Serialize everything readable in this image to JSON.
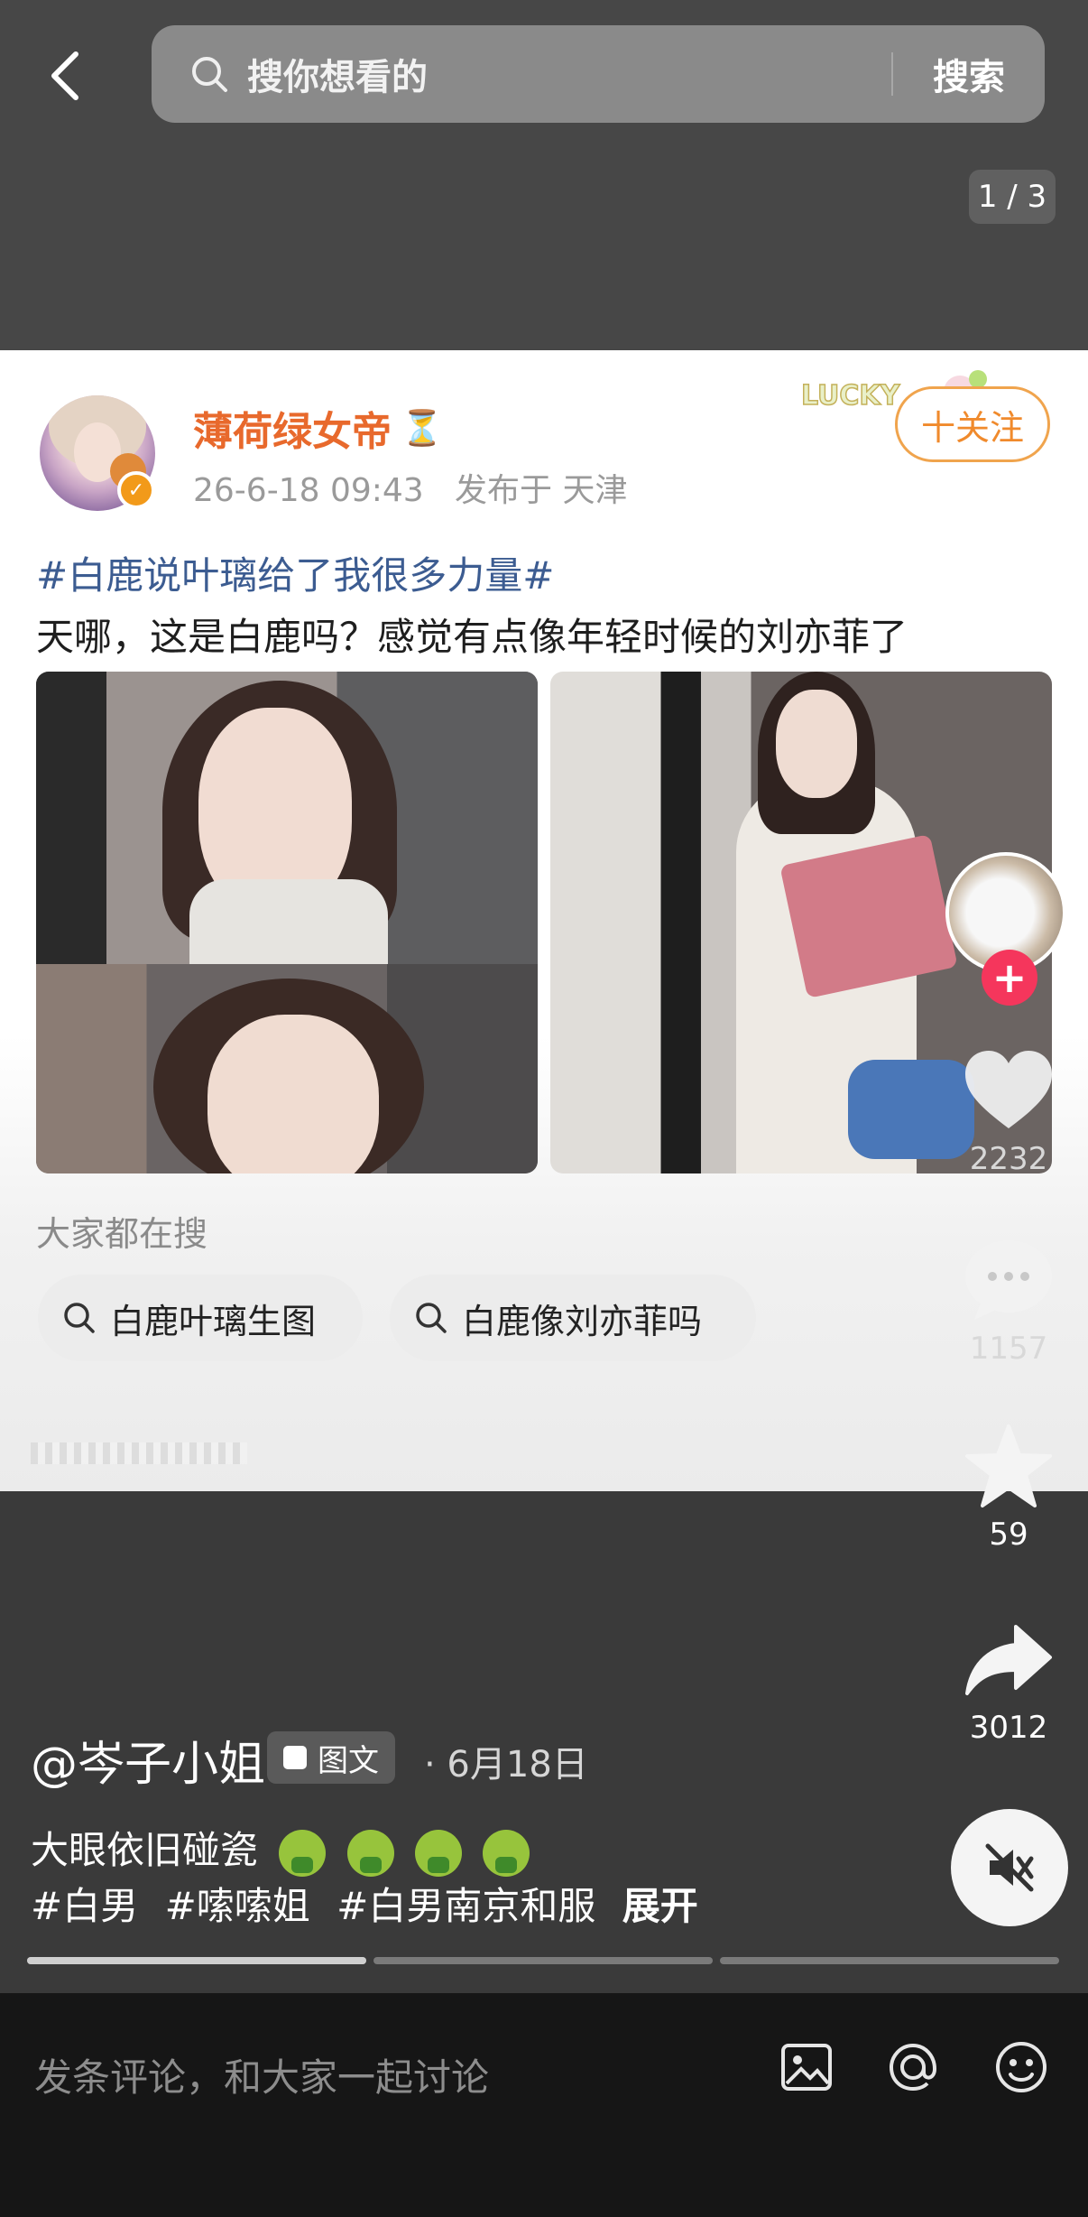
{
  "search": {
    "placeholder": "搜你想看的",
    "button_label": "搜索"
  },
  "pager": {
    "text": "1 / 3"
  },
  "post": {
    "author_name": "薄荷绿女帝",
    "author_emoji": "⏳",
    "timestamp": "26-6-18 09:43",
    "location": "发布于 天津",
    "follow_label": "十关注",
    "sticker_text": "LUCKY",
    "hashtag_title": "#白鹿说叶璃给了我很多力量#",
    "body": "天哪，这是白鹿吗？感觉有点像年轻时候的刘亦菲了",
    "related_label": "大家都在搜",
    "related_searches": [
      "白鹿叶璃生图",
      "白鹿像刘亦菲吗"
    ]
  },
  "actions": {
    "like_count": "2232",
    "comment_count": "1157",
    "favorite_count": "59",
    "share_count": "3012"
  },
  "note": {
    "username": "@岑子小姐",
    "type_label": "图文",
    "date": "· 6月18日",
    "caption": "大眼依旧碰瓷",
    "emoji_count": 4,
    "tags": [
      "#白男",
      "#嗦嗦姐",
      "#白男南京和服"
    ],
    "expand_label": "展开"
  },
  "progress": {
    "segments": 3,
    "active_index": 0,
    "active_fill": 1.0
  },
  "comment": {
    "placeholder": "发条评论，和大家一起讨论"
  },
  "colors": {
    "author": "#e8692c",
    "hashtag": "#3c5c91",
    "follow": "#f08a2c",
    "plus_badge": "#f5365c"
  },
  "icons": [
    "back-icon",
    "search-icon",
    "verified-icon",
    "hourglass-icon",
    "heart-icon",
    "comment-icon",
    "star-icon",
    "share-icon",
    "mute-icon",
    "image-icon",
    "at-icon",
    "emoji-icon"
  ]
}
